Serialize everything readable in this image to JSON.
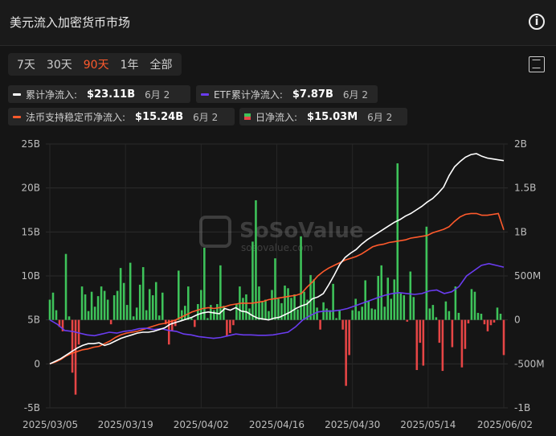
{
  "header": {
    "title": "美元流入加密货币市场",
    "info_icon": "info-icon"
  },
  "tabs": [
    {
      "label": "7天",
      "active": false
    },
    {
      "label": "30天",
      "active": false
    },
    {
      "label": "90天",
      "active": true
    },
    {
      "label": "1年",
      "active": false
    },
    {
      "label": "全部",
      "active": false
    }
  ],
  "legend": {
    "cumulative": {
      "label": "累计净流入:",
      "value": "$23.11B",
      "date": "6月 2",
      "color": "#ffffff"
    },
    "etf": {
      "label": "ETF累计净流入:",
      "value": "$7.87B",
      "date": "6月 2",
      "color": "#6a3cf0"
    },
    "stablecoin": {
      "label": "法币支持稳定币净流入:",
      "value": "$15.24B",
      "date": "6月 2",
      "color": "#ff5a2c"
    },
    "daily": {
      "label": "日净流入:",
      "value": "$15.03M",
      "date": "6月 2"
    }
  },
  "watermark": {
    "brand": "SoSoValue",
    "url": "sosovalue.com"
  },
  "chart_data": {
    "type": "bar+line",
    "x_ticks": [
      "2025/03/05",
      "2025/03/19",
      "2025/04/02",
      "2025/04/16",
      "2025/04/30",
      "2025/05/14",
      "2025/06/02"
    ],
    "y_left": {
      "ticks": [
        "25B",
        "20B",
        "15B",
        "10B",
        "5B",
        "0",
        "-5B"
      ],
      "range": [
        -5,
        25
      ],
      "unit": "B"
    },
    "y_right": {
      "ticks": [
        "2B",
        "1.5B",
        "1B",
        "500M",
        "0",
        "-500M",
        "-1B"
      ],
      "range": [
        -1000,
        2000
      ],
      "unit": "M"
    },
    "grid": true,
    "daily_bars_M": [
      230,
      310,
      110,
      -80,
      -130,
      750,
      40,
      -600,
      -850,
      -280,
      380,
      290,
      100,
      320,
      150,
      270,
      380,
      330,
      230,
      -50,
      280,
      330,
      590,
      420,
      170,
      650,
      40,
      140,
      400,
      600,
      110,
      350,
      280,
      430,
      50,
      310,
      -50,
      -280,
      -130,
      -70,
      560,
      110,
      160,
      380,
      20,
      -80,
      180,
      340,
      820,
      20,
      170,
      110,
      180,
      620,
      160,
      -190,
      -150,
      -60,
      180,
      380,
      250,
      290,
      130,
      890,
      1360,
      380,
      210,
      230,
      100,
      340,
      700,
      240,
      190,
      390,
      360,
      250,
      290,
      120,
      950,
      320,
      230,
      510,
      460,
      140,
      -110,
      200,
      130,
      110,
      410,
      20,
      110,
      -110,
      -750,
      -400,
      110,
      240,
      100,
      150,
      450,
      220,
      130,
      120,
      500,
      620,
      150,
      480,
      240,
      460,
      1780,
      300,
      280,
      -20,
      550,
      260,
      -570,
      -260,
      -520,
      1060,
      130,
      170,
      30,
      -260,
      -580,
      210,
      100,
      -310,
      380,
      80,
      -540,
      -330,
      -40,
      350,
      320,
      80,
      70,
      -50,
      -130,
      -60,
      -30,
      140,
      70,
      -400
    ],
    "cumulative_B": [
      0,
      0.3,
      0.6,
      1.0,
      1.4,
      1.8,
      2.1,
      2.3,
      2.3,
      2.4,
      2.1,
      2.3,
      2.6,
      2.9,
      3.1,
      3.3,
      3.5,
      3.6,
      3.6,
      3.7,
      3.9,
      4.1,
      4.5,
      4.7,
      4.9,
      5.1,
      5.3,
      5.6,
      5.8,
      5.9,
      5.8,
      5.7,
      6.3,
      6.1,
      6.4,
      6.0,
      5.9,
      5.5,
      5.2,
      5.1,
      5.0,
      5.2,
      5.3,
      5.6,
      5.9,
      6.3,
      6.6,
      6.8,
      7.4,
      7.6,
      8.0,
      9.0,
      10.1,
      11.3,
      12.1,
      12.6,
      13.0,
      13.6,
      14.1,
      14.5,
      14.9,
      15.3,
      15.7,
      16.1,
      16.4,
      16.8,
      17.1,
      17.5,
      17.9,
      18.4,
      18.8,
      19.4,
      20.1,
      21.4,
      22.4,
      23.0,
      23.5,
      23.8,
      23.9,
      23.6,
      23.4,
      23.3,
      23.2,
      23.11
    ],
    "stablecoin_B": [
      0,
      0.2,
      0.5,
      0.9,
      1.2,
      1.4,
      1.6,
      1.7,
      1.9,
      2.0,
      2.3,
      2.6,
      3.0,
      3.3,
      3.5,
      3.6,
      3.7,
      3.9,
      4.1,
      4.3,
      4.5,
      4.6,
      4.8,
      5.0,
      5.3,
      5.6,
      5.9,
      6.1,
      6.3,
      6.4,
      6.3,
      6.4,
      6.5,
      6.7,
      6.8,
      6.9,
      6.9,
      6.9,
      7.0,
      7.1,
      7.3,
      7.4,
      7.5,
      7.6,
      7.7,
      7.8,
      8.0,
      8.7,
      9.3,
      10.0,
      10.5,
      10.9,
      11.2,
      11.5,
      11.8,
      12.0,
      12.2,
      12.5,
      12.9,
      13.3,
      13.5,
      13.6,
      13.8,
      13.9,
      14.0,
      14.1,
      14.3,
      14.4,
      14.5,
      14.6,
      14.9,
      15.1,
      15.3,
      15.6,
      16.2,
      16.7,
      17.0,
      17.1,
      17.1,
      16.9,
      16.9,
      17.0,
      17.1,
      15.24
    ],
    "etf_M": [
      0,
      -50,
      -120,
      -130,
      -150,
      -170,
      -180,
      -160,
      -140,
      -150,
      -130,
      -120,
      -100,
      -95,
      -110,
      -100,
      -120,
      -130,
      -160,
      -170,
      -190,
      -200,
      -210,
      -200,
      -180,
      -160,
      -170,
      -170,
      -175,
      -175,
      -170,
      -155,
      -140,
      -80,
      0,
      50,
      90,
      100,
      100,
      110,
      130,
      160,
      190,
      220,
      250,
      280,
      300,
      310,
      300,
      290,
      300,
      330,
      340,
      300,
      320,
      380,
      500,
      560,
      620,
      640,
      620,
      600
    ],
    "etf_start_index": 24
  }
}
